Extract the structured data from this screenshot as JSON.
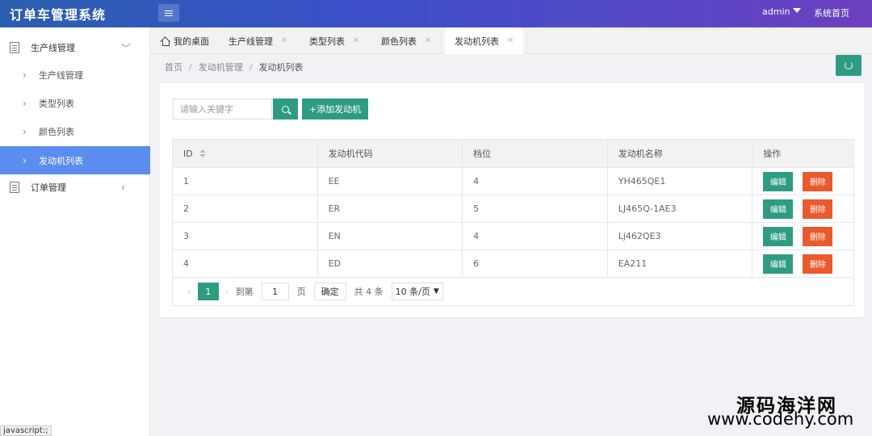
{
  "header": {
    "title": "订单车管理系统",
    "user": "admin",
    "home_link": "系统首页"
  },
  "sidebar": {
    "groups": [
      {
        "label": "生产线管理",
        "icon": "document-icon"
      },
      {
        "label": "订单管理",
        "icon": "document-icon"
      }
    ],
    "items": [
      {
        "label": "生产线管理"
      },
      {
        "label": "类型列表"
      },
      {
        "label": "颜色列表"
      },
      {
        "label": "发动机列表",
        "active": true
      }
    ]
  },
  "tabs": [
    {
      "label": "我的桌面"
    },
    {
      "label": "生产线管理"
    },
    {
      "label": "类型列表"
    },
    {
      "label": "颜色列表"
    },
    {
      "label": "发动机列表",
      "active": true
    }
  ],
  "breadcrumb": [
    "首页",
    "发动机管理",
    "发动机列表"
  ],
  "toolbar": {
    "search_placeholder": "请输入关键字",
    "add_label": "+添加发动机"
  },
  "table": {
    "columns": [
      "ID",
      "发动机代码",
      "档位",
      "发动机名称",
      "操作"
    ],
    "rows": [
      {
        "id": "1",
        "code": "EE",
        "gear": "4",
        "name": "YH465QE1"
      },
      {
        "id": "2",
        "code": "ER",
        "gear": "5",
        "name": "LJ465Q-1AE3"
      },
      {
        "id": "3",
        "code": "EN",
        "gear": "4",
        "name": "Lj462QE3"
      },
      {
        "id": "4",
        "code": "ED",
        "gear": "6",
        "name": "EA211"
      }
    ],
    "edit_label": "编辑",
    "delete_label": "删除"
  },
  "pager": {
    "current": "1",
    "goto_prefix": "到第",
    "goto_value": "1",
    "goto_suffix": "页",
    "confirm": "确定",
    "total": "共 4 条",
    "page_size": "10 条/页"
  },
  "statusbar": "javascript:;",
  "watermark": {
    "line1": "源码海洋网",
    "line2": "www.codehy.com"
  },
  "colors": {
    "accent": "#2e9c82",
    "danger": "#ea5a2c",
    "active_nav": "#5b8def"
  }
}
